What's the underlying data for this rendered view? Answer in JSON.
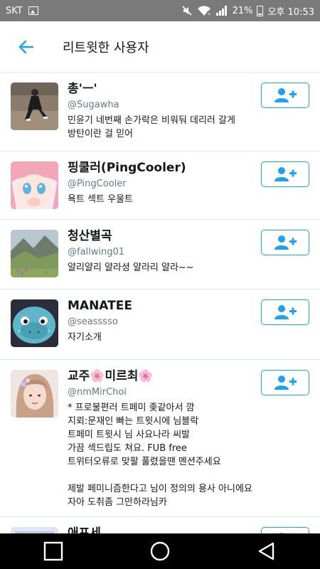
{
  "status_bar": {
    "carrier": "SKT",
    "battery_percent": "21%",
    "time": "오후 10:53",
    "icons": [
      "image-icon",
      "mute-icon",
      "wifi-icon",
      "signal-icon",
      "battery-icon"
    ]
  },
  "header": {
    "title": "리트윗한 사용자",
    "back_icon": "back-arrow-icon"
  },
  "accent_color": "#1da1f2",
  "users": [
    {
      "name": "총'ㅡ'",
      "handle": "@Sugawha",
      "bio": "민윤기 네번째 손가락은 비워둬 데리러 갈게\n방탄이란 걸 믿어",
      "follow_icon": "add-user-icon"
    },
    {
      "name": "핑쿨러(PingCooler)",
      "handle": "@PingCooler",
      "bio": "욕트 섹트 우울트",
      "follow_icon": "add-user-icon"
    },
    {
      "name": "청산별곡",
      "handle": "@fallwing01",
      "bio": "얄리얄리 얄라셩 얄라리 얄라~~",
      "follow_icon": "add-user-icon"
    },
    {
      "name": "MANATEE",
      "handle": "@seasssso",
      "bio": "자기소개",
      "follow_icon": "add-user-icon"
    },
    {
      "name": "교주🌸미르최🌸",
      "handle": "@nmMirChoi",
      "bio": "* 프로불편러 트페미 좆같아서 깜\n지뢰:문재인 빠는 트윗시에 님블락\n트페미 트윗시 님 사요나라  씨발\n가끔 섹드립도 쳐요. FUB free\n트위터오류로 맞팔 풀렸을땐 멘션주세요\n\n제발 페미니즘한다고 님이 정의의 용사 아니에요\n자아 도취좀 그만하라님카",
      "follow_icon": "add-user-icon"
    },
    {
      "name": "애프세",
      "handle": "",
      "bio": "",
      "follow_icon": "add-user-icon"
    }
  ],
  "nav": {
    "recents_icon": "square-recents-icon",
    "home_icon": "circle-home-icon",
    "back_icon": "triangle-back-icon"
  }
}
